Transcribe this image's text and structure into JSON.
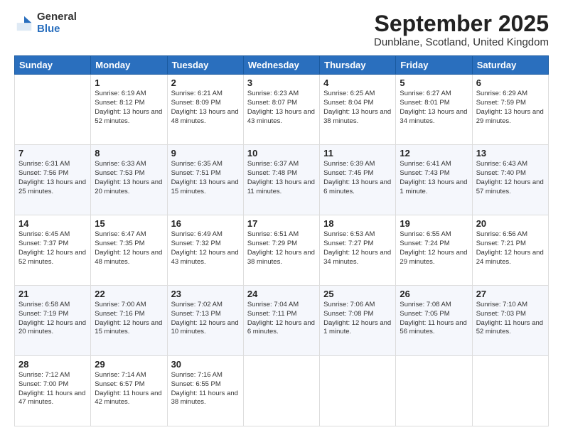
{
  "logo": {
    "general": "General",
    "blue": "Blue"
  },
  "title": "September 2025",
  "subtitle": "Dunblane, Scotland, United Kingdom",
  "days_of_week": [
    "Sunday",
    "Monday",
    "Tuesday",
    "Wednesday",
    "Thursday",
    "Friday",
    "Saturday"
  ],
  "weeks": [
    [
      {
        "day": "",
        "info": ""
      },
      {
        "day": "1",
        "info": "Sunrise: 6:19 AM\nSunset: 8:12 PM\nDaylight: 13 hours\nand 52 minutes."
      },
      {
        "day": "2",
        "info": "Sunrise: 6:21 AM\nSunset: 8:09 PM\nDaylight: 13 hours\nand 48 minutes."
      },
      {
        "day": "3",
        "info": "Sunrise: 6:23 AM\nSunset: 8:07 PM\nDaylight: 13 hours\nand 43 minutes."
      },
      {
        "day": "4",
        "info": "Sunrise: 6:25 AM\nSunset: 8:04 PM\nDaylight: 13 hours\nand 38 minutes."
      },
      {
        "day": "5",
        "info": "Sunrise: 6:27 AM\nSunset: 8:01 PM\nDaylight: 13 hours\nand 34 minutes."
      },
      {
        "day": "6",
        "info": "Sunrise: 6:29 AM\nSunset: 7:59 PM\nDaylight: 13 hours\nand 29 minutes."
      }
    ],
    [
      {
        "day": "7",
        "info": "Sunrise: 6:31 AM\nSunset: 7:56 PM\nDaylight: 13 hours\nand 25 minutes."
      },
      {
        "day": "8",
        "info": "Sunrise: 6:33 AM\nSunset: 7:53 PM\nDaylight: 13 hours\nand 20 minutes."
      },
      {
        "day": "9",
        "info": "Sunrise: 6:35 AM\nSunset: 7:51 PM\nDaylight: 13 hours\nand 15 minutes."
      },
      {
        "day": "10",
        "info": "Sunrise: 6:37 AM\nSunset: 7:48 PM\nDaylight: 13 hours\nand 11 minutes."
      },
      {
        "day": "11",
        "info": "Sunrise: 6:39 AM\nSunset: 7:45 PM\nDaylight: 13 hours\nand 6 minutes."
      },
      {
        "day": "12",
        "info": "Sunrise: 6:41 AM\nSunset: 7:43 PM\nDaylight: 13 hours\nand 1 minute."
      },
      {
        "day": "13",
        "info": "Sunrise: 6:43 AM\nSunset: 7:40 PM\nDaylight: 12 hours\nand 57 minutes."
      }
    ],
    [
      {
        "day": "14",
        "info": "Sunrise: 6:45 AM\nSunset: 7:37 PM\nDaylight: 12 hours\nand 52 minutes."
      },
      {
        "day": "15",
        "info": "Sunrise: 6:47 AM\nSunset: 7:35 PM\nDaylight: 12 hours\nand 48 minutes."
      },
      {
        "day": "16",
        "info": "Sunrise: 6:49 AM\nSunset: 7:32 PM\nDaylight: 12 hours\nand 43 minutes."
      },
      {
        "day": "17",
        "info": "Sunrise: 6:51 AM\nSunset: 7:29 PM\nDaylight: 12 hours\nand 38 minutes."
      },
      {
        "day": "18",
        "info": "Sunrise: 6:53 AM\nSunset: 7:27 PM\nDaylight: 12 hours\nand 34 minutes."
      },
      {
        "day": "19",
        "info": "Sunrise: 6:55 AM\nSunset: 7:24 PM\nDaylight: 12 hours\nand 29 minutes."
      },
      {
        "day": "20",
        "info": "Sunrise: 6:56 AM\nSunset: 7:21 PM\nDaylight: 12 hours\nand 24 minutes."
      }
    ],
    [
      {
        "day": "21",
        "info": "Sunrise: 6:58 AM\nSunset: 7:19 PM\nDaylight: 12 hours\nand 20 minutes."
      },
      {
        "day": "22",
        "info": "Sunrise: 7:00 AM\nSunset: 7:16 PM\nDaylight: 12 hours\nand 15 minutes."
      },
      {
        "day": "23",
        "info": "Sunrise: 7:02 AM\nSunset: 7:13 PM\nDaylight: 12 hours\nand 10 minutes."
      },
      {
        "day": "24",
        "info": "Sunrise: 7:04 AM\nSunset: 7:11 PM\nDaylight: 12 hours\nand 6 minutes."
      },
      {
        "day": "25",
        "info": "Sunrise: 7:06 AM\nSunset: 7:08 PM\nDaylight: 12 hours\nand 1 minute."
      },
      {
        "day": "26",
        "info": "Sunrise: 7:08 AM\nSunset: 7:05 PM\nDaylight: 11 hours\nand 56 minutes."
      },
      {
        "day": "27",
        "info": "Sunrise: 7:10 AM\nSunset: 7:03 PM\nDaylight: 11 hours\nand 52 minutes."
      }
    ],
    [
      {
        "day": "28",
        "info": "Sunrise: 7:12 AM\nSunset: 7:00 PM\nDaylight: 11 hours\nand 47 minutes."
      },
      {
        "day": "29",
        "info": "Sunrise: 7:14 AM\nSunset: 6:57 PM\nDaylight: 11 hours\nand 42 minutes."
      },
      {
        "day": "30",
        "info": "Sunrise: 7:16 AM\nSunset: 6:55 PM\nDaylight: 11 hours\nand 38 minutes."
      },
      {
        "day": "",
        "info": ""
      },
      {
        "day": "",
        "info": ""
      },
      {
        "day": "",
        "info": ""
      },
      {
        "day": "",
        "info": ""
      }
    ]
  ]
}
